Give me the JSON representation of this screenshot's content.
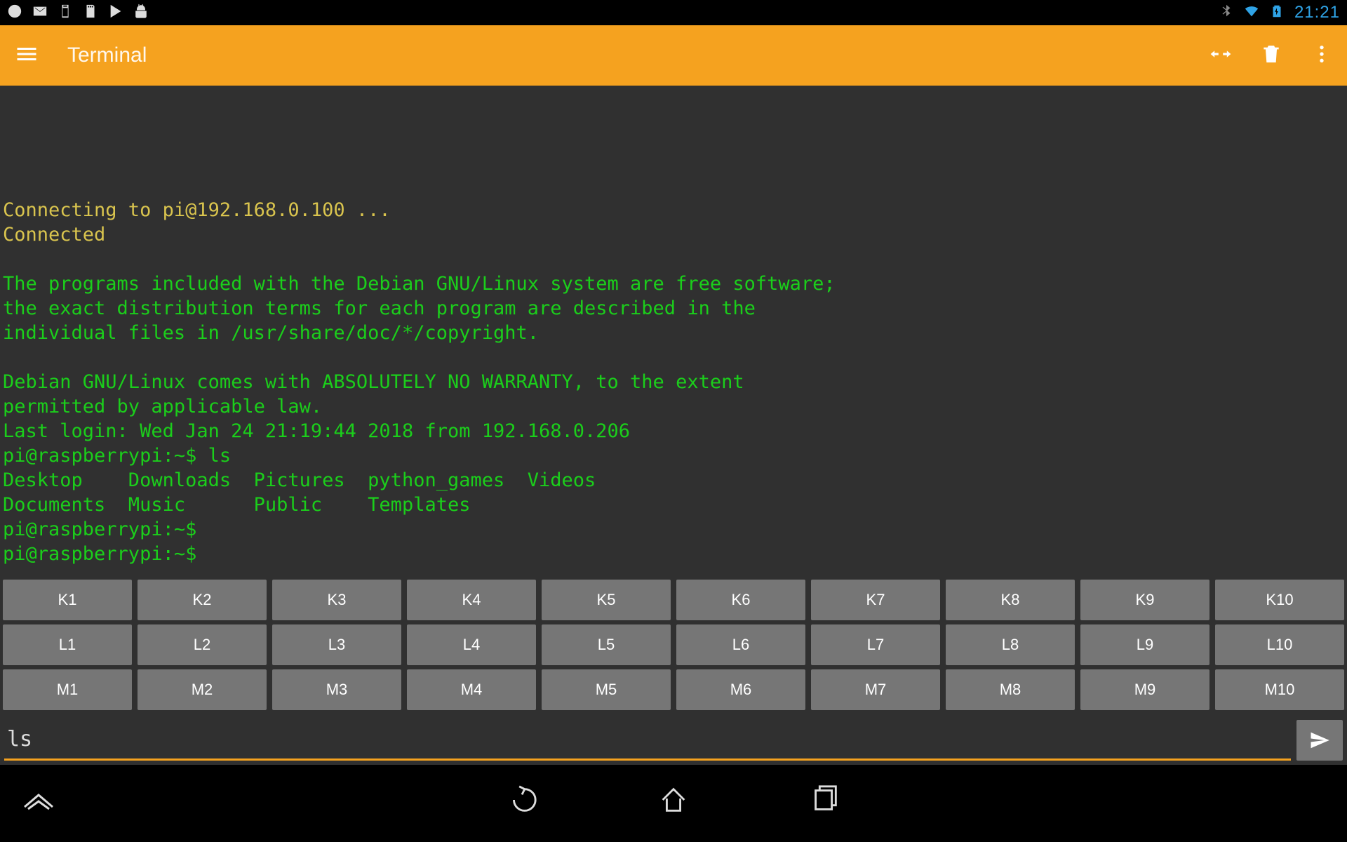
{
  "status": {
    "clock": "21:21"
  },
  "appbar": {
    "title": "Terminal"
  },
  "terminal": {
    "line1": "Connecting to pi@192.168.0.100 ...",
    "line2": "Connected",
    "line3": "",
    "line4": "The programs included with the Debian GNU/Linux system are free software;",
    "line5": "the exact distribution terms for each program are described in the",
    "line6": "individual files in /usr/share/doc/*/copyright.",
    "line7": "",
    "line8": "Debian GNU/Linux comes with ABSOLUTELY NO WARRANTY, to the extent",
    "line9": "permitted by applicable law.",
    "line10": "Last login: Wed Jan 24 21:19:44 2018 from 192.168.0.206",
    "line11": "pi@raspberrypi:~$ ls",
    "line12a": "Desktop    Downloads  Pictures  python_games  Videos",
    "line12b": "Documents  Music      Public    Templates",
    "line13": "pi@raspberrypi:~$ ",
    "line14": "pi@raspberrypi:~$ "
  },
  "macros": {
    "row1": [
      "K1",
      "K2",
      "K3",
      "K4",
      "K5",
      "K6",
      "K7",
      "K8",
      "K9",
      "K10"
    ],
    "row2": [
      "L1",
      "L2",
      "L3",
      "L4",
      "L5",
      "L6",
      "L7",
      "L8",
      "L9",
      "L10"
    ],
    "row3": [
      "M1",
      "M2",
      "M3",
      "M4",
      "M5",
      "M6",
      "M7",
      "M8",
      "M9",
      "M10"
    ]
  },
  "input": {
    "value": "ls"
  },
  "colors": {
    "accent": "#f5a21f",
    "term_green": "#1bce1b",
    "term_yellow": "#d9c44e"
  }
}
